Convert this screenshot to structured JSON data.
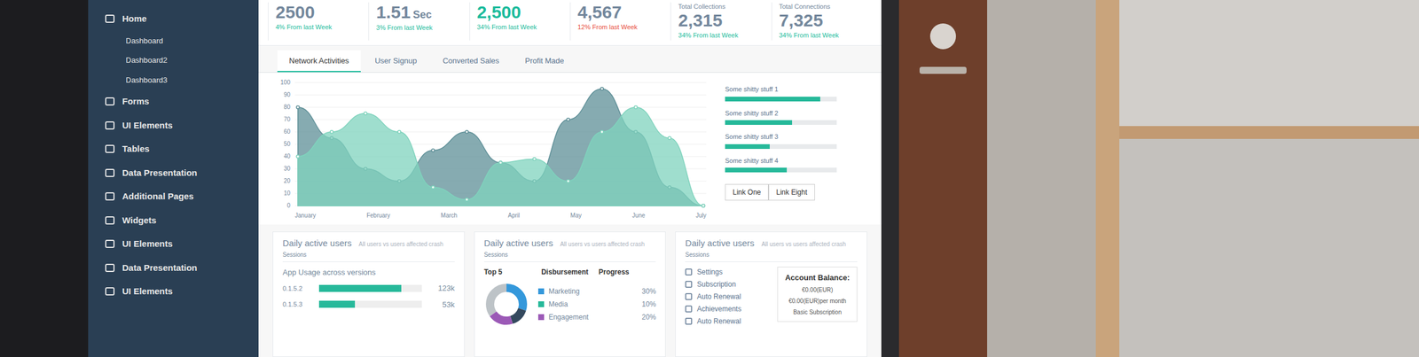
{
  "sidebar": {
    "items": [
      {
        "label": "Home",
        "kind": "item"
      },
      {
        "label": "Dashboard",
        "kind": "subitem"
      },
      {
        "label": "Dashboard2",
        "kind": "subitem"
      },
      {
        "label": "Dashboard3",
        "kind": "subitem"
      },
      {
        "label": "Forms",
        "kind": "item"
      },
      {
        "label": "UI Elements",
        "kind": "item"
      },
      {
        "label": "Tables",
        "kind": "item"
      },
      {
        "label": "Data Presentation",
        "kind": "item"
      },
      {
        "label": "Additional Pages",
        "kind": "item"
      },
      {
        "label": "Widgets",
        "kind": "item"
      },
      {
        "label": "UI Elements",
        "kind": "item"
      },
      {
        "label": "Data Presentation",
        "kind": "item"
      },
      {
        "label": "UI Elements",
        "kind": "item"
      }
    ]
  },
  "stats": [
    {
      "value": "2500",
      "change": "4% From last Week",
      "trend": "up",
      "highlight": false
    },
    {
      "value": "1.51",
      "unit": "Sec",
      "change": "3% From last Week",
      "trend": "up",
      "highlight": false
    },
    {
      "value": "2,500",
      "change": "34% From last Week",
      "trend": "up",
      "highlight": true
    },
    {
      "value": "4,567",
      "change": "12% From last Week",
      "trend": "down",
      "highlight": false
    },
    {
      "label": "Total Collections",
      "value": "2,315",
      "change": "34% From last Week",
      "trend": "up",
      "highlight": false
    },
    {
      "label": "Total Connections",
      "value": "7,325",
      "change": "34% From last Week",
      "trend": "up",
      "highlight": false
    }
  ],
  "tabs": [
    {
      "label": "Network Activities",
      "selected": true
    },
    {
      "label": "User Signup",
      "selected": false
    },
    {
      "label": "Converted Sales",
      "selected": false
    },
    {
      "label": "Profit Made",
      "selected": false
    }
  ],
  "chart": {
    "y_ticks": [
      "100",
      "90",
      "80",
      "70",
      "60",
      "50",
      "40",
      "30",
      "20",
      "10",
      "0"
    ],
    "x_labels": [
      "January",
      "February",
      "March",
      "April",
      "May",
      "June",
      "July"
    ],
    "series": [
      {
        "values": [
          80,
          55,
          30,
          20,
          45,
          60,
          35,
          20,
          70,
          95,
          60,
          15,
          0
        ],
        "color": "#5e8f97"
      },
      {
        "values": [
          40,
          60,
          75,
          60,
          15,
          5,
          35,
          38,
          20,
          60,
          80,
          55,
          0
        ],
        "color": "#7fd3bd"
      }
    ]
  },
  "progress": [
    {
      "label": "Some shitty stuff 1",
      "level": 0.85
    },
    {
      "label": "Some shitty stuff 2",
      "level": 0.6
    },
    {
      "label": "Some shitty stuff 3",
      "level": 0.4
    },
    {
      "label": "Some shitty stuff 4",
      "level": 0.55
    }
  ],
  "buttons": [
    "Link One",
    "Link Eight"
  ],
  "cards": [
    {
      "title": "Daily active users",
      "subtitle": "All users vs users affected crash",
      "caption": "Sessions",
      "section": "App Usage across versions",
      "bars": [
        {
          "label": "0.1.5.2",
          "level": 0.8,
          "value": "123k"
        },
        {
          "label": "0.1.5.3",
          "level": 0.35,
          "value": "53k"
        }
      ]
    },
    {
      "title": "Daily active users",
      "subtitle": "All users vs users affected crash",
      "caption": "Sessions",
      "columns": [
        "Top 5",
        "Disbursement",
        "Progress"
      ],
      "rows": [
        {
          "label": "Marketing",
          "value": "30%",
          "color": "#3498db"
        },
        {
          "label": "Media",
          "value": "10%",
          "color": "#26b99a"
        },
        {
          "label": "Engagement",
          "value": "20%",
          "color": "#9b59b6"
        }
      ],
      "donut": {
        "values": [
          30,
          15,
          20,
          35
        ],
        "colors": [
          "#3498db",
          "#34495e",
          "#9b59b6",
          "#bdc3c7"
        ]
      }
    },
    {
      "title": "Daily active users",
      "subtitle": "All users vs users affected crash",
      "caption": "Sessions",
      "items": [
        "Settings",
        "Subscription",
        "Auto Renewal",
        "Achievements",
        "Auto Renewal"
      ],
      "account": {
        "title": "Account Balance:",
        "lines": [
          "€0.00(EUR)",
          "€0.00(EUR)per month",
          "Basic Subscription"
        ]
      }
    }
  ]
}
